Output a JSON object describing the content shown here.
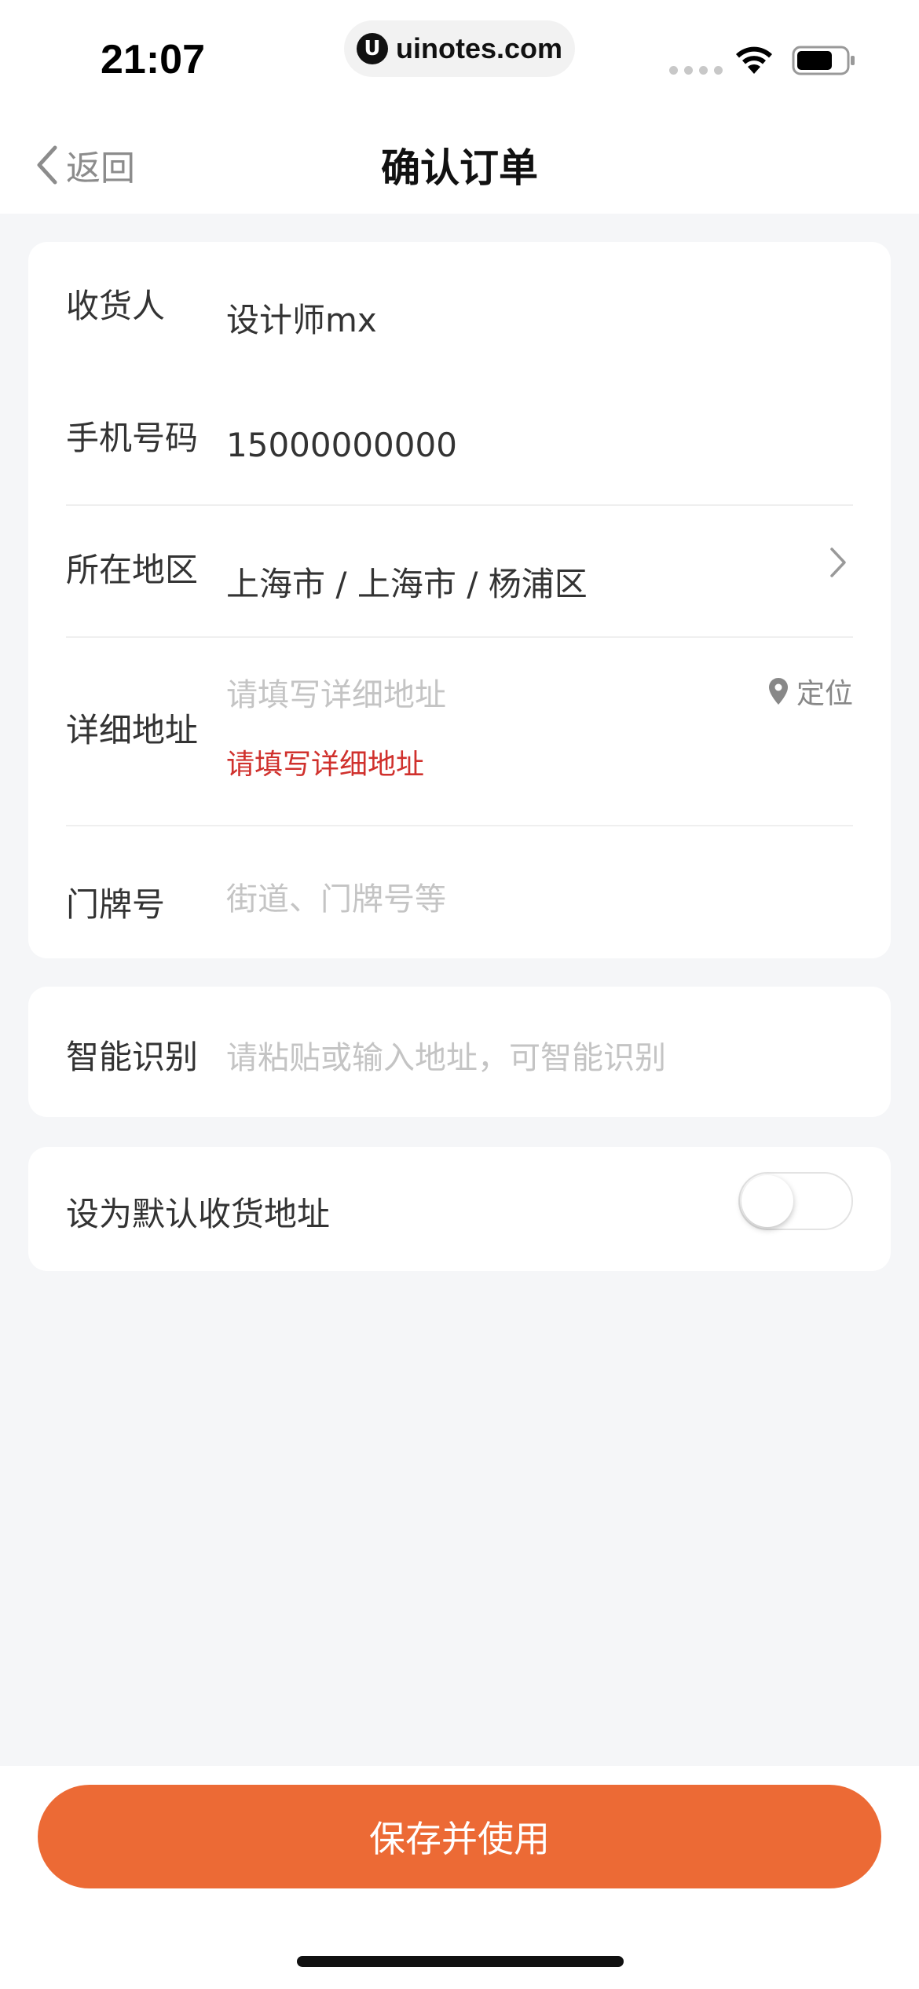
{
  "status_bar": {
    "time": "21:07",
    "url": "uinotes.com",
    "logo_glyph": "U"
  },
  "nav": {
    "back_label": "返回",
    "title": "确认订单"
  },
  "address_form": {
    "recipient": {
      "label": "收货人",
      "value": "设计师mx"
    },
    "phone": {
      "label": "手机号码",
      "value": "15000000000"
    },
    "region": {
      "label": "所在地区",
      "value": "上海市 / 上海市 / 杨浦区"
    },
    "detail": {
      "label": "详细地址",
      "placeholder": "请填写详细地址",
      "error": "请填写详细地址",
      "locate_label": "定位"
    },
    "house_number": {
      "label": "门牌号",
      "placeholder": "街道、门牌号等"
    }
  },
  "smart_recognition": {
    "label": "智能识别",
    "placeholder": "请粘贴或输入地址，可智能识别"
  },
  "default_address": {
    "label": "设为默认收货地址",
    "enabled": false
  },
  "footer": {
    "save_label": "保存并使用"
  },
  "colors": {
    "accent": "#ec6a35",
    "error": "#d0312d",
    "background": "#f5f6f8"
  }
}
